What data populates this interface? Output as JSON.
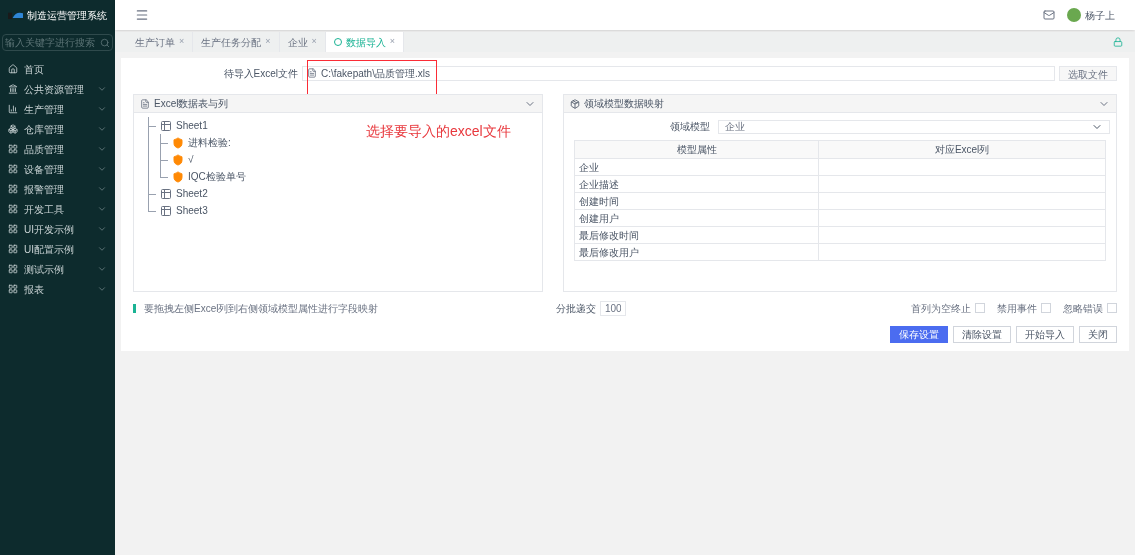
{
  "sidebar": {
    "title": "制造运营管理系统",
    "search": {
      "placeholder": "输入关键字进行搜索"
    },
    "items": [
      {
        "label": "首页",
        "expandable": false
      },
      {
        "label": "公共资源管理",
        "expandable": true
      },
      {
        "label": "生产管理",
        "expandable": true
      },
      {
        "label": "仓库管理",
        "expandable": true
      },
      {
        "label": "品质管理",
        "expandable": true
      },
      {
        "label": "设备管理",
        "expandable": true
      },
      {
        "label": "报警管理",
        "expandable": true
      },
      {
        "label": "开发工具",
        "expandable": true
      },
      {
        "label": "UI开发示例",
        "expandable": true
      },
      {
        "label": "UI配置示例",
        "expandable": true
      },
      {
        "label": "测试示例",
        "expandable": true
      },
      {
        "label": "报表",
        "expandable": true
      }
    ]
  },
  "header": {
    "user": "杨子上"
  },
  "tabs": [
    {
      "label": "生产订单",
      "close": "×",
      "selected": false
    },
    {
      "label": "生产任务分配",
      "close": "×",
      "selected": false
    },
    {
      "label": "企业",
      "close": "×",
      "selected": false
    },
    {
      "label": "数据导入",
      "close": "×",
      "selected": true
    }
  ],
  "file": {
    "label": "待导入Excel文件",
    "value": "C:\\fakepath\\品质管理.xls",
    "button": "选取文件"
  },
  "annotation": "选择要导入的excel文件",
  "excel_panel": {
    "title": "Excel数据表与列",
    "tree": [
      {
        "label": "Sheet1",
        "kind": "sheet",
        "children": [
          {
            "label": "进料检验:",
            "kind": "column"
          },
          {
            "label": "√",
            "kind": "column"
          },
          {
            "label": "IQC检验单号",
            "kind": "column"
          }
        ]
      },
      {
        "label": "Sheet2",
        "kind": "sheet"
      },
      {
        "label": "Sheet3",
        "kind": "sheet"
      }
    ]
  },
  "mapping_panel": {
    "title": "领域模型数据映射",
    "model_label": "领域模型",
    "model_value": "企业",
    "columns": [
      "模型属性",
      "对应Excel列"
    ],
    "rows": [
      "企业",
      "企业描述",
      "创建时间",
      "创建用户",
      "最后修改时间",
      "最后修改用户"
    ]
  },
  "hint": "要拖拽左侧Excel列到右侧领域模型属性进行字段映射",
  "batch": {
    "label": "分批递交",
    "value": "100"
  },
  "options": [
    {
      "label": "首列为空终止",
      "checked": false
    },
    {
      "label": "禁用事件",
      "checked": false
    },
    {
      "label": "忽略错误",
      "checked": false
    }
  ],
  "buttons": [
    {
      "label": "保存设置",
      "primary": true
    },
    {
      "label": "清除设置",
      "primary": false
    },
    {
      "label": "开始导入",
      "primary": false
    },
    {
      "label": "关闭",
      "primary": false
    }
  ]
}
